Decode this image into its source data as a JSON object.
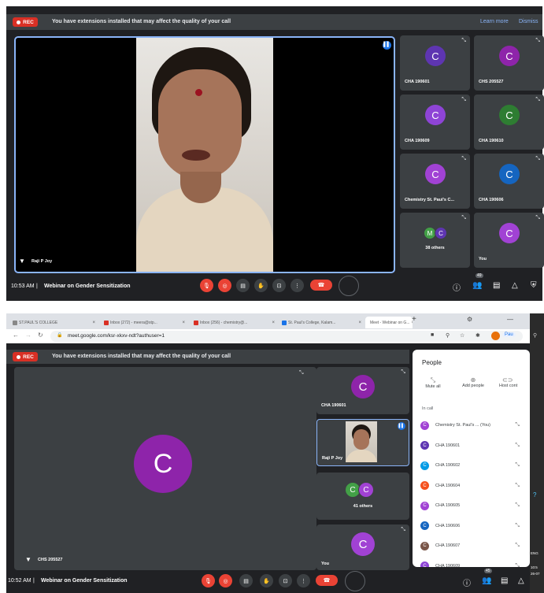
{
  "top": {
    "rec_label": "REC",
    "banner_text": "You have extensions installed that may affect the quality of your call",
    "learn_more": "Learn more",
    "dismiss": "Dismiss",
    "speaker_name": "Raji P Joy",
    "tiles": [
      {
        "name": "CHA 190601",
        "letter": "C",
        "color": "#5e35b1"
      },
      {
        "name": "CHS 205527",
        "letter": "C",
        "color": "#8e24aa"
      },
      {
        "name": "CHA 190609",
        "letter": "C",
        "color": "#8e44d6"
      },
      {
        "name": "CHA 190610",
        "letter": "C",
        "color": "#2e7d32"
      },
      {
        "name": "Chemistry St. Paul's C...",
        "letter": "C",
        "color": "#a142d4"
      },
      {
        "name": "CHA 190606",
        "letter": "C",
        "color": "#1565c0"
      },
      {
        "name": "38 others",
        "letters": [
          "M",
          "C"
        ],
        "colors": [
          "#43a047",
          "#5e35b1"
        ]
      },
      {
        "name": "You",
        "letter": "C",
        "color": "#a142d4"
      }
    ],
    "time": "10:53 AM",
    "separator": "|",
    "meeting": "Webinar on Gender Sensitization",
    "people_count": "49"
  },
  "browser": {
    "tabs": [
      "ST.PAUL'S COLLEGE",
      "Inbox (272) - meera@stp...",
      "Inbox (256) - chemistry@...",
      "St. Paul's College, Kalam...",
      "Meet - Webinar on G..."
    ],
    "new_tab": "+",
    "url": "meet.google.com/ksr-xkxv-ndt?authuser=1",
    "profile": "Pau"
  },
  "bottom": {
    "rec_label": "REC",
    "banner_text": "You have extensions installed that may affect the quality of your call",
    "main_letter": "C",
    "main_name": "CHS 205527",
    "tiles": [
      {
        "name": "CHA 190601",
        "letter": "C",
        "color": "#8e24aa"
      },
      {
        "name": "Raji P Joy"
      },
      {
        "name": "41 others",
        "letters": [
          "C",
          "C"
        ],
        "colors": [
          "#43a047",
          "#a142d4"
        ]
      },
      {
        "name": "You",
        "letter": "C",
        "color": "#a142d4"
      }
    ],
    "time": "10:52 AM",
    "separator": "|",
    "meeting": "Webinar on Gender Sensitization",
    "people_count": "45"
  },
  "people": {
    "title": "People",
    "actions": [
      "Mute all",
      "Add people",
      "Host cont"
    ],
    "section": "In call",
    "list": [
      {
        "name": "Chemistry St. Paul's ... (You)",
        "color": "#a142d4",
        "letter": "C"
      },
      {
        "name": "CHA 190601",
        "color": "#5e35b1",
        "letter": "C"
      },
      {
        "name": "CHA 190602",
        "color": "#039be5",
        "letter": "C"
      },
      {
        "name": "CHA 190604",
        "color": "#f4511e",
        "letter": "C"
      },
      {
        "name": "CHA 190605",
        "color": "#a142d4",
        "letter": "C"
      },
      {
        "name": "CHA 190606",
        "color": "#1565c0",
        "letter": "C"
      },
      {
        "name": "CHA 190607",
        "color": "#795548",
        "letter": "C"
      },
      {
        "name": "CHA 190609",
        "color": "#8e44d6",
        "letter": "C"
      }
    ]
  },
  "taskbar": {
    "lang": "ENG",
    "time": "10:5",
    "date": "26-07"
  }
}
